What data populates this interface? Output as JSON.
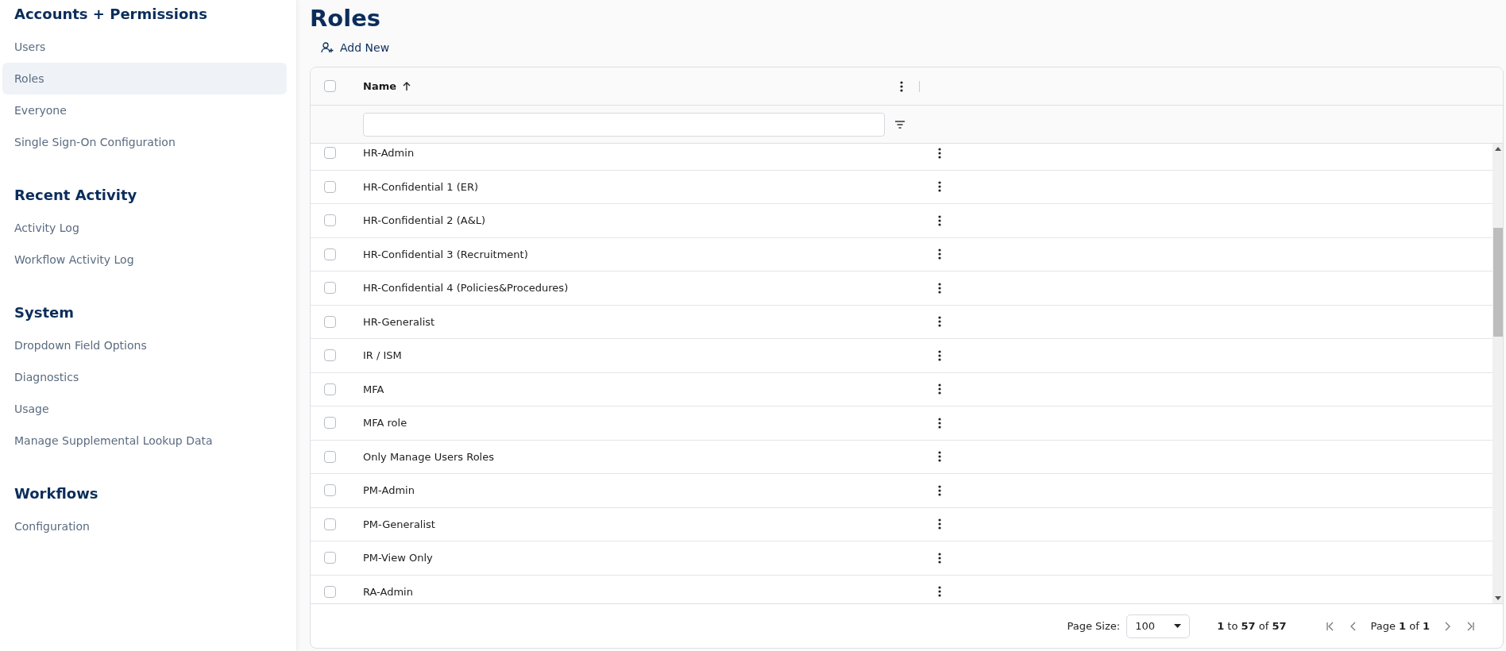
{
  "sidebar": {
    "sections": [
      {
        "title": "Accounts + Permissions",
        "items": [
          {
            "label": "Users",
            "selected": false
          },
          {
            "label": "Roles",
            "selected": true
          },
          {
            "label": "Everyone",
            "selected": false
          },
          {
            "label": "Single Sign-On Configuration",
            "selected": false
          }
        ]
      },
      {
        "title": "Recent Activity",
        "items": [
          {
            "label": "Activity Log",
            "selected": false
          },
          {
            "label": "Workflow Activity Log",
            "selected": false
          }
        ]
      },
      {
        "title": "System",
        "items": [
          {
            "label": "Dropdown Field Options",
            "selected": false
          },
          {
            "label": "Diagnostics",
            "selected": false
          },
          {
            "label": "Usage",
            "selected": false
          },
          {
            "label": "Manage Supplemental Lookup Data",
            "selected": false
          }
        ]
      },
      {
        "title": "Workflows",
        "items": [
          {
            "label": "Configuration",
            "selected": false
          }
        ]
      }
    ]
  },
  "page_title": "Roles",
  "add_button": "Add New",
  "table": {
    "header_checked": false,
    "columns": [
      {
        "label": "Name",
        "sort_ascending": true
      }
    ],
    "rows": [
      {
        "name": "HR-Admin",
        "checked": false
      },
      {
        "name": "HR-Confidential 1 (ER)",
        "checked": false
      },
      {
        "name": "HR-Confidential 2 (A&L)",
        "checked": false
      },
      {
        "name": "HR-Confidential 3 (Recruitment)",
        "checked": false
      },
      {
        "name": "HR-Confidential 4 (Policies&Procedures)",
        "checked": false
      },
      {
        "name": "HR-Generalist",
        "checked": false
      },
      {
        "name": "IR / ISM",
        "checked": false
      },
      {
        "name": "MFA",
        "checked": false
      },
      {
        "name": "MFA role",
        "checked": false
      },
      {
        "name": "Only Manage Users Roles",
        "checked": false
      },
      {
        "name": "PM-Admin",
        "checked": false
      },
      {
        "name": "PM-Generalist",
        "checked": false
      },
      {
        "name": "PM-View Only",
        "checked": false
      },
      {
        "name": "RA-Admin",
        "checked": false
      }
    ]
  },
  "pagination": {
    "page_size_label": "Page Size:",
    "page_size": "100",
    "range": "**1** to **57** of **57**",
    "page": "Page **1** of **1**"
  }
}
